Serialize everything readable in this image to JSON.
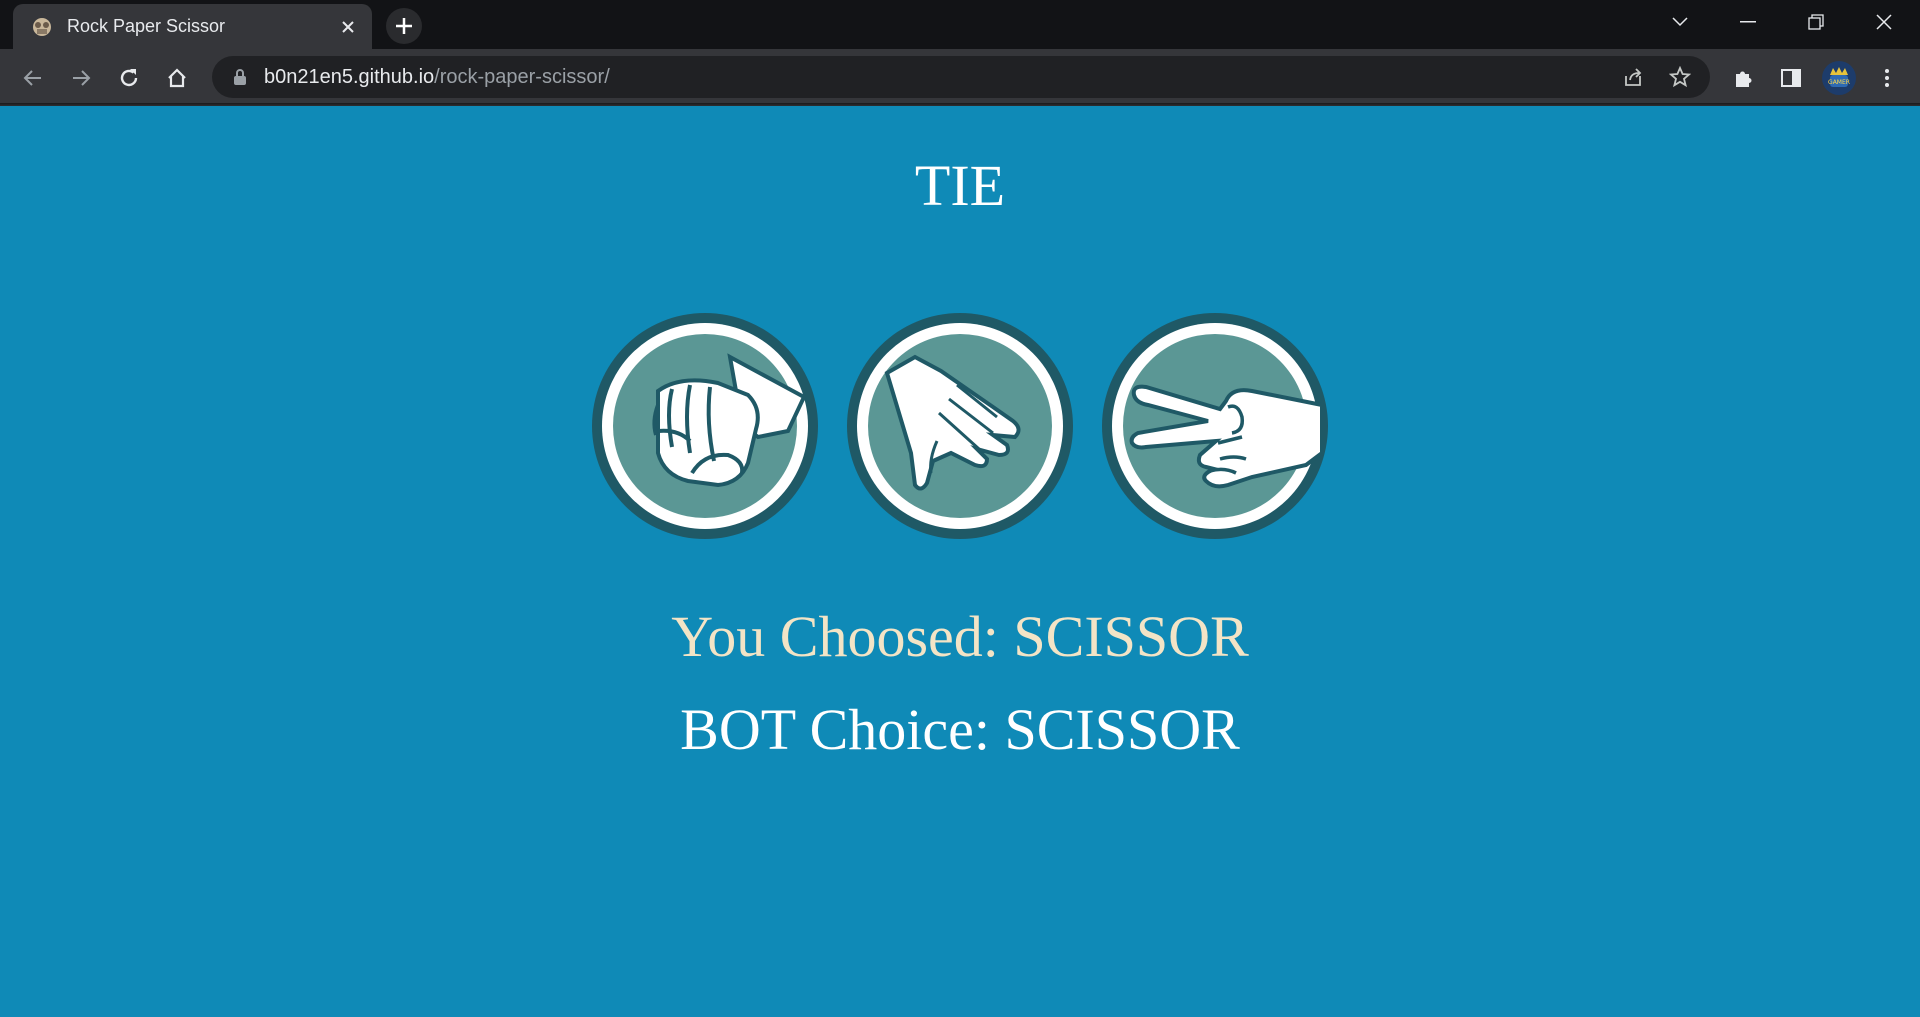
{
  "browser": {
    "tab_title": "Rock Paper Scissor",
    "url_host": "b0n21en5.github.io",
    "url_path": "/rock-paper-scissor/",
    "icons": {
      "tab_close": "close-icon",
      "new_tab": "plus-icon",
      "back": "arrow-left-icon",
      "forward": "arrow-right-icon",
      "reload": "reload-icon",
      "home": "home-icon",
      "lock": "lock-icon",
      "share": "share-icon",
      "bookmark": "star-icon",
      "extensions": "puzzle-icon",
      "side_panel": "side-panel-icon",
      "menu": "kebab-menu-icon"
    },
    "avatar_label": "GAMER"
  },
  "game": {
    "result": "TIE",
    "choices": [
      {
        "name": "rock",
        "icon": "fist-icon"
      },
      {
        "name": "paper",
        "icon": "open-hand-icon"
      },
      {
        "name": "scissor",
        "icon": "peace-hand-icon"
      }
    ],
    "you_choice_text": "You Choosed: SCISSOR",
    "bot_choice_text": "BOT Choice: SCISSOR"
  },
  "colors": {
    "background": "#0f8ab7",
    "circle_outer": "#1f5966",
    "circle_inner": "#5b9795",
    "ring": "#ffffff",
    "you_text": "#f3e4c6",
    "bot_text": "#ffffff"
  }
}
